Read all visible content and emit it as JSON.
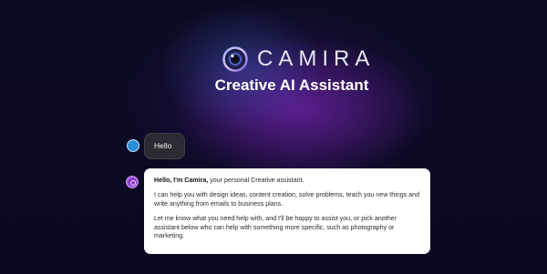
{
  "brand": {
    "name": "CAMIRA",
    "tagline": "Creative AI Assistant",
    "logo_icon": "camera-lens-icon"
  },
  "conversation": {
    "user_message": "Hello",
    "assistant": {
      "greeting_bold": "Hello, I'm Camira,",
      "greeting_rest": " your personal Creative assistant.",
      "paragraph_2": "I can help you with design ideas, content creation, solve problems, teach you new things and write anything from emails to business plans.",
      "paragraph_3": "Let me know what you need help with, and I'll be happy to assist you, or pick another assistant below who can help with something more specific, such as photography or marketing."
    }
  },
  "colors": {
    "background": "#08071a",
    "glow_purple": "#8c28c8",
    "user_avatar": "#2b8fd6",
    "assistant_avatar": "#8a35c9",
    "user_bubble": "#2b2b33",
    "assistant_bubble": "#ffffff"
  }
}
